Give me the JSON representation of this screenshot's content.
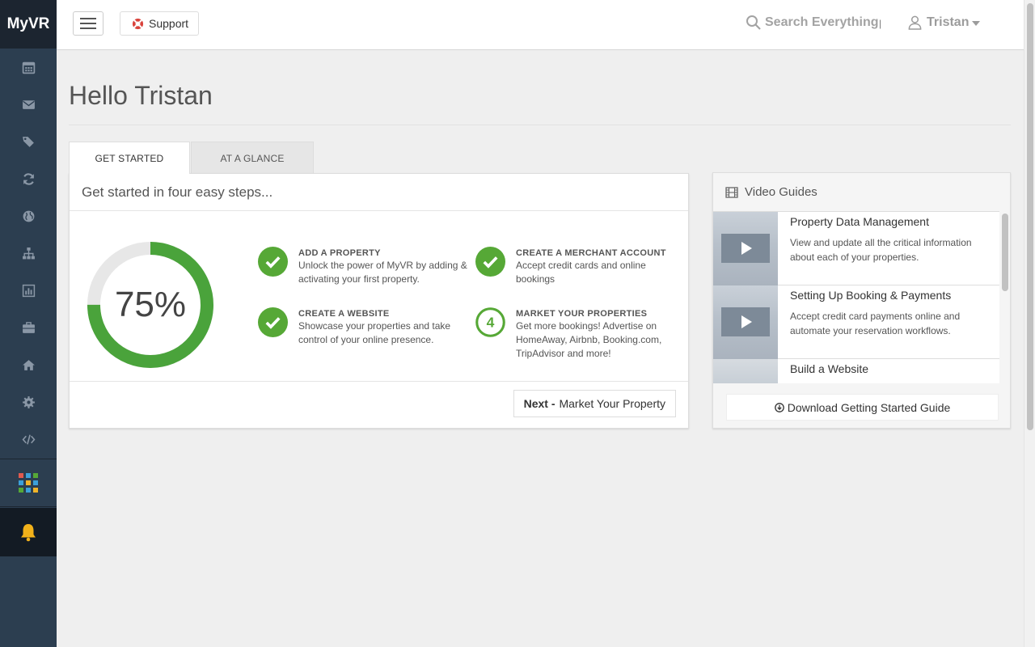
{
  "sidebar": {
    "brand": "MyVR",
    "items": [
      {
        "icon": "calendar-icon"
      },
      {
        "icon": "envelope-icon"
      },
      {
        "icon": "tags-icon"
      },
      {
        "icon": "refresh-icon"
      },
      {
        "icon": "globe-icon"
      },
      {
        "icon": "sitemap-icon"
      },
      {
        "icon": "bar-chart-icon"
      },
      {
        "icon": "briefcase-icon"
      },
      {
        "icon": "home-icon"
      },
      {
        "icon": "gear-icon"
      },
      {
        "icon": "code-icon"
      }
    ],
    "apps_icon": "apps-grid-icon",
    "bell_icon": "bell-icon"
  },
  "topbar": {
    "support_label": "Support",
    "search_label": "Search Everything",
    "separator": "|",
    "user_name": "Tristan"
  },
  "main": {
    "greeting": "Hello Tristan",
    "tabs": [
      {
        "label": "GET STARTED",
        "active": true
      },
      {
        "label": "AT A GLANCE",
        "active": false
      }
    ]
  },
  "steps_card": {
    "title": "Get started in four easy steps...",
    "progress_label": "75%",
    "progress": 0.75,
    "steps": [
      {
        "title": "ADD A PROPERTY",
        "description": "Unlock the power of MyVR by adding & activating your first property.",
        "done": true
      },
      {
        "title": "CREATE A MERCHANT ACCOUNT",
        "description": "Accept credit cards and online bookings",
        "done": true
      },
      {
        "title": "CREATE A WEBSITE",
        "description": "Showcase your properties and take control of your online presence.",
        "done": true
      },
      {
        "title": "MARKET YOUR PROPERTIES",
        "description": "Get more bookings! Advertise on HomeAway, Airbnb, Booking.com, TripAdvisor and more!",
        "done": false,
        "number": "4"
      }
    ],
    "next_prefix": "Next -",
    "next_label": "Market Your Property"
  },
  "video_guides": {
    "title": "Video Guides",
    "items": [
      {
        "title": "Property Data Management",
        "description": "View and update all the critical information about each of your properties."
      },
      {
        "title": "Setting Up Booking & Payments",
        "description": "Accept credit card payments online and automate your reservation workflows."
      },
      {
        "title": "Build a Website",
        "description": ""
      }
    ],
    "download_label": "Download Getting Started Guide"
  },
  "colors": {
    "sidebar": "#2c3e50",
    "accent_green": "#56a836",
    "progress_green": "#4aa33b"
  }
}
